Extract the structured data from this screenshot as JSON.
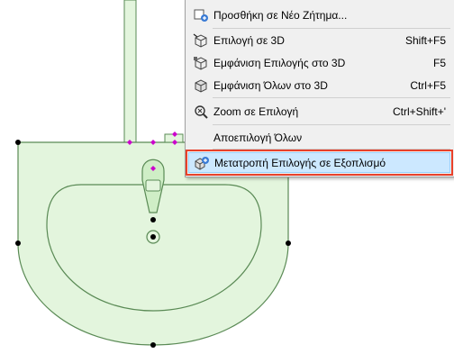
{
  "context_menu": {
    "items": [
      {
        "label": "Προσθήκη σε Νέο Ζήτημα...",
        "shortcut": "",
        "icon": "add-issue-icon"
      },
      {
        "label": "Επιλογή σε 3D",
        "shortcut": "Shift+F5",
        "icon": "select-3d-icon"
      },
      {
        "label": "Εμφάνιση Επιλογής στο 3D",
        "shortcut": "F5",
        "icon": "show-selection-3d-icon"
      },
      {
        "label": "Εμφάνιση Όλων στο 3D",
        "shortcut": "Ctrl+F5",
        "icon": "show-all-3d-icon"
      },
      {
        "label": "Zoom σε Επιλογή",
        "shortcut": "Ctrl+Shift+'",
        "icon": "zoom-selection-icon"
      },
      {
        "label": "Αποεπιλογή Όλων",
        "shortcut": "",
        "icon": ""
      },
      {
        "label": "Μετατροπή Επιλογής σε Εξοπλισμό",
        "shortcut": "",
        "icon": "convert-to-object-icon"
      }
    ],
    "highlighted_index": 6
  },
  "colors": {
    "fixture_fill": "#e3f5dd",
    "fixture_stroke": "#5a8a55",
    "highlight_bg": "#cce8ff",
    "highlight_border": "#e8402a",
    "hotspot_magenta": "#cc00cc"
  }
}
